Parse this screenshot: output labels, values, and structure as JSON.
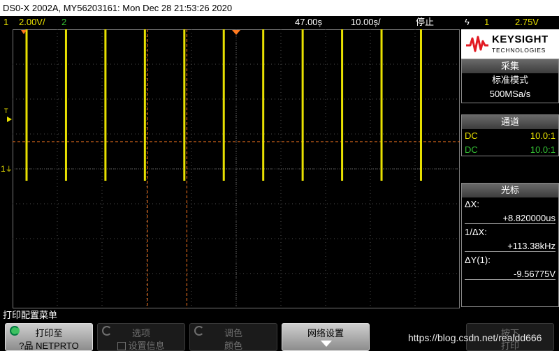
{
  "title": "DS0-X 2002A, MY56203161: Mon Dec 28 21:53:26 2020",
  "status": {
    "ch1_num": "1",
    "ch1_scale": "2.00V/",
    "ch2_num": "2",
    "time_delay": "47.00ș",
    "time_scale": "10.00ș/",
    "run_state": "停止",
    "trigger_slope": "ϟ",
    "trigger_source": "1",
    "trigger_level": "2.75V"
  },
  "brand": {
    "name": "KEYSIGHT",
    "sub": "TECHNOLOGIES"
  },
  "acquisition": {
    "header": "采集",
    "mode": "标准模式",
    "rate": "500MSa/s"
  },
  "channels": {
    "header": "通道",
    "rows": [
      {
        "coupling": "DC",
        "probe": "10.0:1",
        "color": "#e8e000"
      },
      {
        "coupling": "DC",
        "probe": "10.0:1",
        "color": "#34c034"
      }
    ]
  },
  "cursors": {
    "header": "光标",
    "dx_label": "ΔX:",
    "dx_value": "+8.820000us",
    "inv_dx_label": "1/ΔX:",
    "inv_dx_value": "+113.38kHz",
    "dy_label": "ΔY(1):",
    "dy_value": "-9.56775V"
  },
  "markers": {
    "trigger_level": "T",
    "ch1_ground": "1"
  },
  "menu_title": "打印配置菜单",
  "softkeys": [
    {
      "line1": "打印至",
      "line2": "?品 NETPRTO",
      "active": true
    },
    {
      "line1": "选项",
      "line2": "设置信息",
      "active": false
    },
    {
      "line1": "调色",
      "line2": "颜色",
      "active": false
    },
    {
      "line1": "网络设置",
      "line2": "",
      "active": true
    },
    {
      "line1": "按下",
      "line2": "打印",
      "active": false
    }
  ],
  "watermark": "https://blog.csdn.net/realdd666",
  "colors": {
    "ch1": "#e8e000",
    "ch2": "#34c034",
    "cursor": "#ff7a20",
    "grid": "#505050"
  },
  "waveform": {
    "channel": 1,
    "period_us": 8.82,
    "high_level_V": 0,
    "low_level_V": -9.57,
    "pulse_count_visible": 11,
    "time_per_div_us": 10,
    "volts_per_div": 2
  }
}
